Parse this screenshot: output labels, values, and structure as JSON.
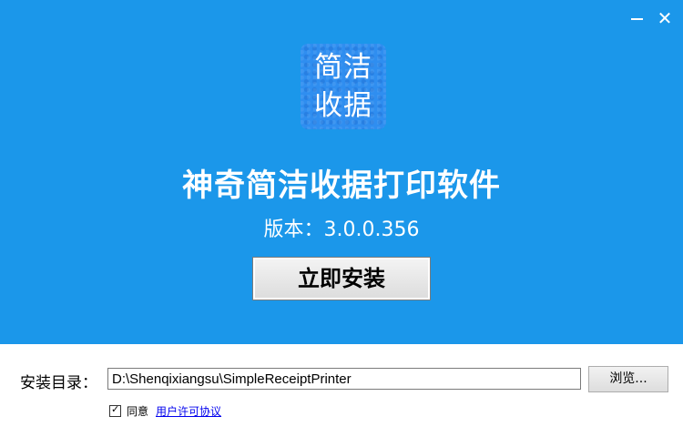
{
  "window": {
    "minimize_label": "",
    "close_label": "✕"
  },
  "logo": {
    "line1": "简洁",
    "line2": "收据"
  },
  "app": {
    "title": "神奇简洁收据打印软件",
    "version_text": "版本：3.0.0.356",
    "install_label": "立即安装"
  },
  "install_dir": {
    "label": "安装目录：",
    "value": "D:\\Shenqixiangsu\\SimpleReceiptPrinter",
    "browse_label": "浏览..."
  },
  "agreement": {
    "checked": true,
    "agree_label": "同意",
    "link_label": "用户许可协议"
  },
  "colors": {
    "header_bg": "#1b97ea",
    "logo_bg": "#2f8ef0",
    "link": "#0000ee"
  }
}
